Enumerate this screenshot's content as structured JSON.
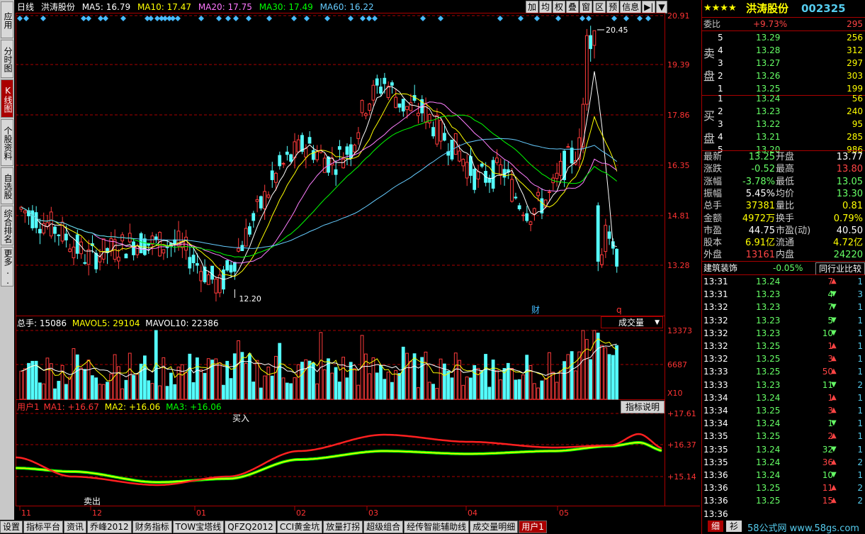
{
  "left_tabs": [
    {
      "label": "应用",
      "active": false
    },
    {
      "label": "分时图",
      "active": false
    },
    {
      "label": "K线图",
      "active": true
    },
    {
      "label": "个股资料",
      "active": false
    },
    {
      "label": "自选股",
      "active": false
    },
    {
      "label": "综合排名",
      "active": false
    },
    {
      "label": "更多..",
      "active": false
    }
  ],
  "header": {
    "period": "日线",
    "stock": "洪涛股份",
    "ma5": "MA5: 16.79",
    "ma10": "MA10: 17.47",
    "ma20": "MA20: 17.75",
    "ma30": "MA30: 17.49",
    "ma60": "MA60: 16.22"
  },
  "toolbar": [
    "加",
    "均",
    "权",
    "叠",
    "窗",
    "区",
    "预",
    "信息",
    "▶|",
    "▼"
  ],
  "price_axis": [
    "20.91",
    "19.39",
    "17.86",
    "16.35",
    "14.81",
    "13.28"
  ],
  "annotations": {
    "high": "20.45",
    "low": "12.20",
    "cai": "财",
    "q": "q"
  },
  "volume": {
    "header_total": "总手: 15086",
    "header_mavol5": "MAVOL5: 29104",
    "header_mavol10": "MAVOL10: 22386",
    "dropdown": "成交量",
    "axis": [
      "13373",
      "6687",
      "X10"
    ]
  },
  "indicator": {
    "name": "用户1",
    "ma1": "MA1: +16.67",
    "ma2": "MA2: +16.06",
    "ma3": "MA3: +16.06",
    "button": "指标说明",
    "axis": [
      "+17.61",
      "+16.37",
      "+15.14"
    ],
    "buy_label": "买入",
    "sell_label": "卖出"
  },
  "time_axis": [
    "11",
    "12",
    "01",
    "02",
    "03",
    "04",
    "05"
  ],
  "bottom_tabs": [
    {
      "label": "设置",
      "active": false
    },
    {
      "label": "指标平台",
      "active": false
    },
    {
      "label": "资讯",
      "active": false
    },
    {
      "label": "乔峰2012",
      "active": false
    },
    {
      "label": "财务指标",
      "active": false
    },
    {
      "label": "TOW宝塔线",
      "active": false
    },
    {
      "label": "QFZQ2012",
      "active": false
    },
    {
      "label": "CCI黄金坑",
      "active": false
    },
    {
      "label": "放量打拐",
      "active": false
    },
    {
      "label": "超级组合",
      "active": false
    },
    {
      "label": "经传智能辅助线",
      "active": false
    },
    {
      "label": "成交量明细",
      "active": false
    },
    {
      "label": "用户1",
      "active": true
    }
  ],
  "quote": {
    "stars": "★★★★",
    "name": "洪涛股份",
    "code": "002325",
    "weibi_label": "委比",
    "weibi_value": "+9.73%",
    "weibi_diff": "295",
    "sell_label_1": "卖",
    "sell_label_2": "盘",
    "buy_label_1": "买",
    "buy_label_2": "盘",
    "sell": [
      {
        "lvl": "5",
        "price": "13.29",
        "vol": "256"
      },
      {
        "lvl": "4",
        "price": "13.28",
        "vol": "312"
      },
      {
        "lvl": "3",
        "price": "13.27",
        "vol": "297"
      },
      {
        "lvl": "2",
        "price": "13.26",
        "vol": "303"
      },
      {
        "lvl": "1",
        "price": "13.25",
        "vol": "199"
      }
    ],
    "buy": [
      {
        "lvl": "1",
        "price": "13.24",
        "vol": "56"
      },
      {
        "lvl": "2",
        "price": "13.23",
        "vol": "240"
      },
      {
        "lvl": "3",
        "price": "13.22",
        "vol": "95"
      },
      {
        "lvl": "4",
        "price": "13.21",
        "vol": "285"
      },
      {
        "lvl": "5",
        "price": "13.20",
        "vol": "986"
      }
    ],
    "stats": [
      {
        "l1": "最新",
        "v1": "13.25",
        "l2": "开盘",
        "v2": "13.77",
        "c1": "#6f6",
        "c2": "#fff"
      },
      {
        "l1": "涨跌",
        "v1": "-0.52",
        "l2": "最高",
        "v2": "13.80",
        "c1": "#6f6",
        "c2": "#f44"
      },
      {
        "l1": "涨幅",
        "v1": "-3.78%",
        "l2": "最低",
        "v2": "13.05",
        "c1": "#6f6",
        "c2": "#6f6"
      },
      {
        "l1": "振幅",
        "v1": "5.45%",
        "l2": "均价",
        "v2": "13.30",
        "c1": "#fff",
        "c2": "#6f6"
      },
      {
        "l1": "总手",
        "v1": "37381",
        "l2": "量比",
        "v2": "0.81",
        "c1": "#ff0",
        "c2": "#ff0"
      },
      {
        "l1": "金额",
        "v1": "4972万",
        "l2": "换手",
        "v2": "0.79%",
        "c1": "#ff0",
        "c2": "#ff0"
      },
      {
        "l1": "市盈",
        "v1": "44.75",
        "l2": "市盈(动)",
        "v2": "40.50",
        "c1": "#fff",
        "c2": "#fff"
      },
      {
        "l1": "股本",
        "v1": "6.91亿",
        "l2": "流通",
        "v2": "4.72亿",
        "c1": "#ff0",
        "c2": "#ff0"
      },
      {
        "l1": "外盘",
        "v1": "13161",
        "l2": "内盘",
        "v2": "24220",
        "c1": "#f44",
        "c2": "#6f6"
      }
    ],
    "industry": "建筑装饰",
    "industry_change": "-0.05%",
    "compare_button": "同行业比较",
    "ticks": [
      {
        "t": "13:31",
        "p": "13.24",
        "v": "7",
        "d": "up",
        "n": "1"
      },
      {
        "t": "13:31",
        "p": "13.23",
        "v": "4",
        "d": "down",
        "n": "3"
      },
      {
        "t": "13:32",
        "p": "13.23",
        "v": "7",
        "d": "down",
        "n": "1"
      },
      {
        "t": "13:32",
        "p": "13.23",
        "v": "5",
        "d": "down",
        "n": "1"
      },
      {
        "t": "13:32",
        "p": "13.23",
        "v": "10",
        "d": "down",
        "n": "1"
      },
      {
        "t": "13:32",
        "p": "13.25",
        "v": "1",
        "d": "up",
        "n": "1"
      },
      {
        "t": "13:32",
        "p": "13.25",
        "v": "3",
        "d": "up",
        "n": "1"
      },
      {
        "t": "13:33",
        "p": "13.25",
        "v": "50",
        "d": "up",
        "n": "1"
      },
      {
        "t": "13:33",
        "p": "13.23",
        "v": "11",
        "d": "down",
        "n": "2"
      },
      {
        "t": "13:34",
        "p": "13.24",
        "v": "1",
        "d": "up",
        "n": "1"
      },
      {
        "t": "13:34",
        "p": "13.25",
        "v": "3",
        "d": "up",
        "n": "1"
      },
      {
        "t": "13:34",
        "p": "13.24",
        "v": "1",
        "d": "down",
        "n": "1"
      },
      {
        "t": "13:35",
        "p": "13.25",
        "v": "2",
        "d": "up",
        "n": "1"
      },
      {
        "t": "13:35",
        "p": "13.24",
        "v": "32",
        "d": "down",
        "n": "1"
      },
      {
        "t": "13:35",
        "p": "13.24",
        "v": "36",
        "d": "up",
        "n": "2"
      },
      {
        "t": "13:36",
        "p": "13.24",
        "v": "10",
        "d": "down",
        "n": "1"
      },
      {
        "t": "13:36",
        "p": "13.25",
        "v": "11",
        "d": "up",
        "n": "2"
      },
      {
        "t": "13:36",
        "p": "13.25",
        "v": "15",
        "d": "up",
        "n": "2"
      },
      {
        "t": "13:36",
        "p": "",
        "v": "",
        "d": "",
        "n": ""
      }
    ],
    "bottom_tab": "细",
    "bottom_tab2": "衫"
  },
  "watermark": "58公式网 www.58gs.com",
  "colors": {
    "up": "#ff3b3b",
    "down": "#54fcfc",
    "ma5": "#ffffff",
    "ma10": "#ffff00",
    "ma20": "#ff7fff",
    "ma30": "#00ff00",
    "ma60": "#6cf"
  }
}
